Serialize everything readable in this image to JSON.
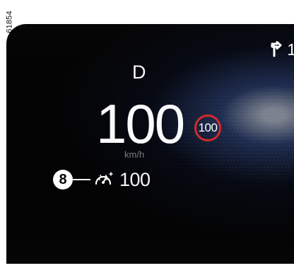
{
  "image_id": "61854",
  "instrument_panel": {
    "gear": "D",
    "speed": "100",
    "speed_unit": "km/h",
    "speed_limit_sign": "100",
    "limiter_value": "100",
    "callout_number": "8",
    "navigation_partial_text": "1"
  },
  "icons": {
    "navigation": "route-turn-icon",
    "limiter": "speed-limiter-icon"
  },
  "colors": {
    "screen_background": "#050505",
    "sign_ring": "#d42a2a",
    "glow": "#6f8fe8"
  }
}
